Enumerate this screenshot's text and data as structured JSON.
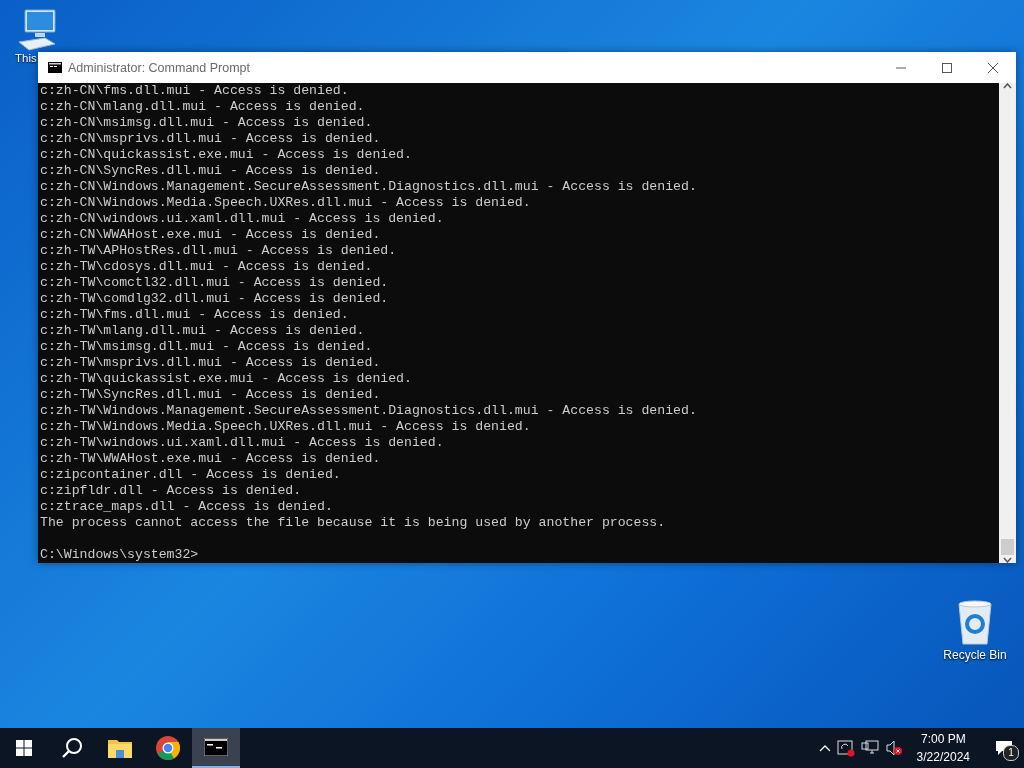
{
  "desktop_icons": [
    {
      "kind": "computer",
      "label": "This"
    },
    {
      "kind": "recycle",
      "label": "Recycle Bin"
    }
  ],
  "window": {
    "title": "Administrator: Command Prompt"
  },
  "console": {
    "lines": [
      "c:zh-CN\\fms.dll.mui - Access is denied.",
      "c:zh-CN\\mlang.dll.mui - Access is denied.",
      "c:zh-CN\\msimsg.dll.mui - Access is denied.",
      "c:zh-CN\\msprivs.dll.mui - Access is denied.",
      "c:zh-CN\\quickassist.exe.mui - Access is denied.",
      "c:zh-CN\\SyncRes.dll.mui - Access is denied.",
      "c:zh-CN\\Windows.Management.SecureAssessment.Diagnostics.dll.mui - Access is denied.",
      "c:zh-CN\\Windows.Media.Speech.UXRes.dll.mui - Access is denied.",
      "c:zh-CN\\windows.ui.xaml.dll.mui - Access is denied.",
      "c:zh-CN\\WWAHost.exe.mui - Access is denied.",
      "c:zh-TW\\APHostRes.dll.mui - Access is denied.",
      "c:zh-TW\\cdosys.dll.mui - Access is denied.",
      "c:zh-TW\\comctl32.dll.mui - Access is denied.",
      "c:zh-TW\\comdlg32.dll.mui - Access is denied.",
      "c:zh-TW\\fms.dll.mui - Access is denied.",
      "c:zh-TW\\mlang.dll.mui - Access is denied.",
      "c:zh-TW\\msimsg.dll.mui - Access is denied.",
      "c:zh-TW\\msprivs.dll.mui - Access is denied.",
      "c:zh-TW\\quickassist.exe.mui - Access is denied.",
      "c:zh-TW\\SyncRes.dll.mui - Access is denied.",
      "c:zh-TW\\Windows.Management.SecureAssessment.Diagnostics.dll.mui - Access is denied.",
      "c:zh-TW\\Windows.Media.Speech.UXRes.dll.mui - Access is denied.",
      "c:zh-TW\\windows.ui.xaml.dll.mui - Access is denied.",
      "c:zh-TW\\WWAHost.exe.mui - Access is denied.",
      "c:zipcontainer.dll - Access is denied.",
      "c:zipfldr.dll - Access is denied.",
      "c:ztrace_maps.dll - Access is denied.",
      "The process cannot access the file because it is being used by another process."
    ],
    "prompt": "C:\\Windows\\system32>"
  },
  "taskbar": {
    "items": [
      {
        "kind": "start",
        "selected": false
      },
      {
        "kind": "search",
        "selected": false
      },
      {
        "kind": "folder",
        "selected": false
      },
      {
        "kind": "chrome",
        "selected": false
      },
      {
        "kind": "terminal",
        "selected": true
      }
    ],
    "tray": {
      "time": "7:00 PM",
      "date": "3/22/2024",
      "notifications": "1"
    }
  }
}
